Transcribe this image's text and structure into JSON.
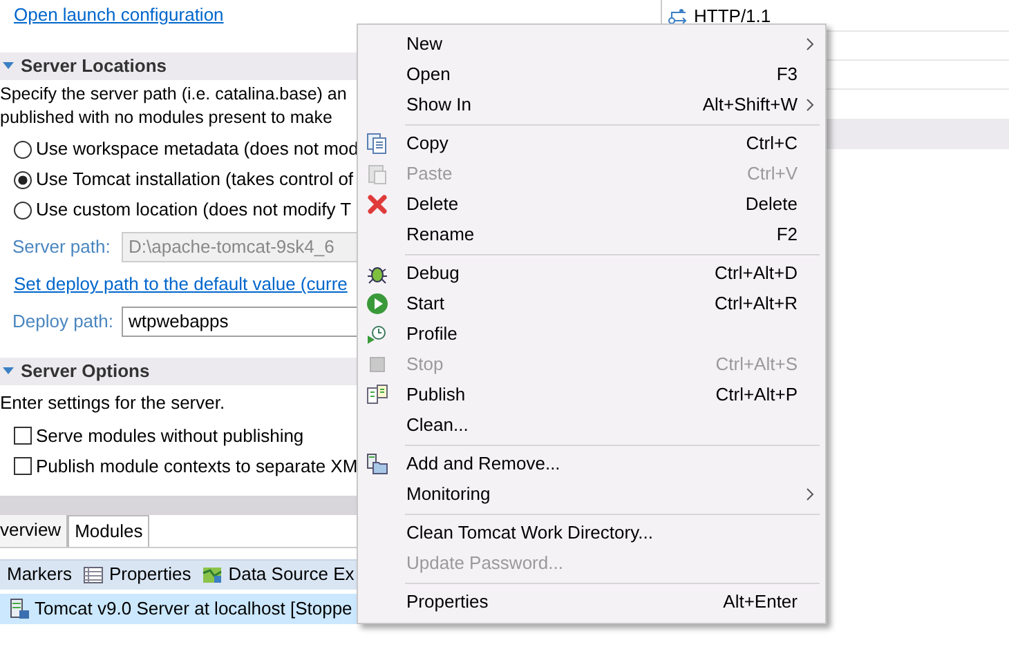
{
  "launch_link": "Open launch configuration",
  "server_locations": {
    "title": "Server Locations",
    "expanded": true,
    "description": [
      "Specify the server path (i.e. catalina.base) an",
      "published with no modules present to make"
    ],
    "options": [
      {
        "label": "Use workspace metadata (does not mod",
        "selected": false
      },
      {
        "label": "Use Tomcat installation (takes control of",
        "selected": true
      },
      {
        "label": "Use custom location (does not modify T",
        "selected": false
      }
    ],
    "server_path": {
      "label": "Server path:",
      "value": "D:\\apache-tomcat-9sk4_6",
      "disabled": true
    },
    "deploy_link": "Set deploy path to the default value (curre",
    "deploy_path": {
      "label": "Deploy path:",
      "value": "wtpwebapps",
      "disabled": false
    }
  },
  "server_options": {
    "title": "Server Options",
    "expanded": true,
    "description": "Enter settings for the server.",
    "options": [
      {
        "label": "Serve modules without publishing",
        "checked": false
      },
      {
        "label": "Publish module contexts to separate XM",
        "checked": false
      }
    ]
  },
  "editor_tabs": [
    {
      "label": "verview",
      "selected": false
    },
    {
      "label": "Modules",
      "selected": true
    }
  ],
  "views_toolbar": [
    {
      "label": "Markers"
    },
    {
      "label": "Properties"
    },
    {
      "label": "Data Source Ex"
    }
  ],
  "servers": [
    {
      "label": "Tomcat v9.0 Server at localhost  [Stoppe",
      "selected": true
    }
  ],
  "right_table": {
    "rows": [
      "HTTP/1.1"
    ]
  },
  "context_menu": {
    "groups": [
      [
        {
          "label": "New",
          "submenu": true,
          "disabled": false
        },
        {
          "label": "Open",
          "shortcut": "F3",
          "disabled": false
        },
        {
          "label": "Show In",
          "shortcut": "Alt+Shift+W",
          "submenu": true,
          "disabled": false
        }
      ],
      [
        {
          "label": "Copy",
          "shortcut": "Ctrl+C",
          "disabled": false
        },
        {
          "label": "Paste",
          "shortcut": "Ctrl+V",
          "disabled": true
        },
        {
          "label": "Delete",
          "shortcut": "Delete",
          "disabled": false
        },
        {
          "label": "Rename",
          "shortcut": "F2",
          "disabled": false
        }
      ],
      [
        {
          "label": "Debug",
          "shortcut": "Ctrl+Alt+D",
          "disabled": false
        },
        {
          "label": "Start",
          "shortcut": "Ctrl+Alt+R",
          "disabled": false
        },
        {
          "label": "Profile",
          "disabled": false
        },
        {
          "label": "Stop",
          "shortcut": "Ctrl+Alt+S",
          "disabled": true
        },
        {
          "label": "Publish",
          "shortcut": "Ctrl+Alt+P",
          "disabled": false
        },
        {
          "label": "Clean...",
          "disabled": false
        }
      ],
      [
        {
          "label": "Add and Remove...",
          "disabled": false
        },
        {
          "label": "Monitoring",
          "submenu": true,
          "disabled": false
        }
      ],
      [
        {
          "label": "Clean Tomcat Work Directory...",
          "disabled": false
        },
        {
          "label": "Update Password...",
          "disabled": true
        }
      ],
      [
        {
          "label": "Properties",
          "shortcut": "Alt+Enter",
          "disabled": false
        }
      ]
    ]
  }
}
